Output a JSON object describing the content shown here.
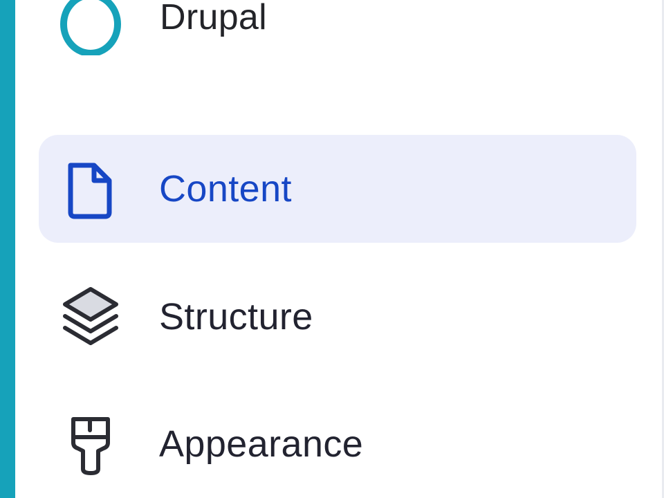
{
  "brand": {
    "name": "Drupal",
    "icon": "drupal-ring-icon",
    "color": "#16a2ba"
  },
  "nav": {
    "items": [
      {
        "label": "Content",
        "icon": "document-icon",
        "active": true
      },
      {
        "label": "Structure",
        "icon": "layers-icon",
        "active": false
      },
      {
        "label": "Appearance",
        "icon": "brush-icon",
        "active": false
      }
    ]
  },
  "colors": {
    "accent": "#16a2ba",
    "active_bg": "#eceefb",
    "active_text": "#1747c5",
    "text": "#222330"
  }
}
